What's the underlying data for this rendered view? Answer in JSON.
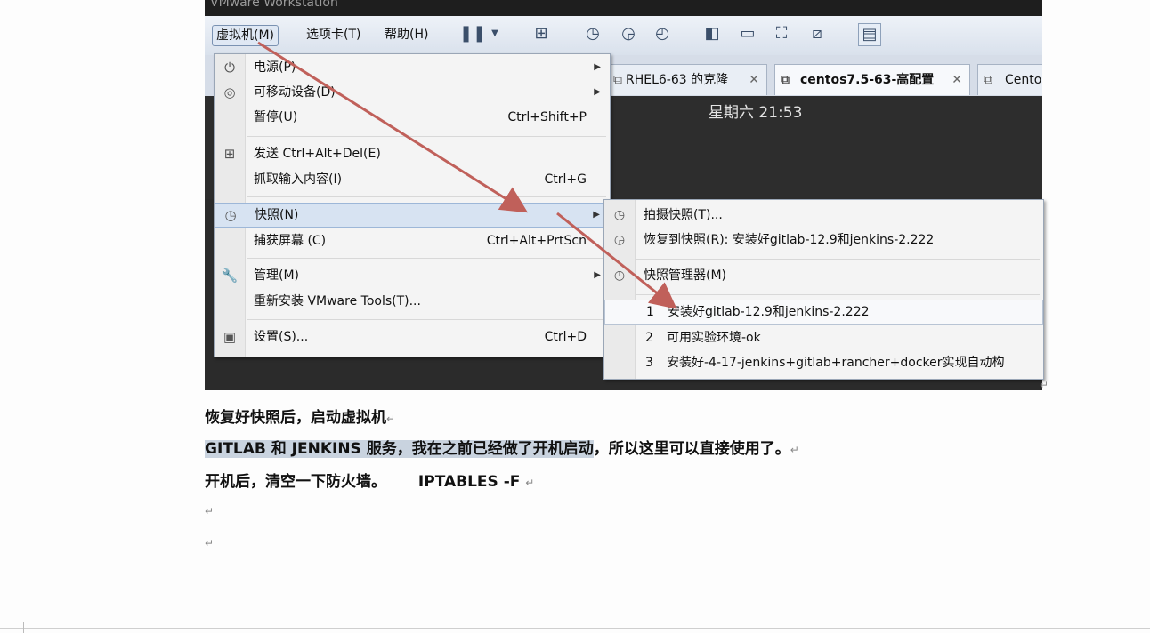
{
  "window": {
    "title": "VMware Workstation"
  },
  "menubar": {
    "vm": "虚拟机(M)",
    "tabs": "选项卡(T)",
    "help": "帮助(H)"
  },
  "tabs": [
    {
      "label": "RHEL6-63 的克隆",
      "active": false
    },
    {
      "label": "centos7.5-63-高配置",
      "active": true
    },
    {
      "label": "Centos",
      "active": false
    }
  ],
  "console": {
    "clock": "星期六 21:53"
  },
  "menu": {
    "items": [
      {
        "label": "电源(P)",
        "shortcut": "",
        "submenu": true,
        "icon": "power-icon"
      },
      {
        "label": "可移动设备(D)",
        "shortcut": "",
        "submenu": true,
        "icon": "disc-icon"
      },
      {
        "label": "暂停(U)",
        "shortcut": "Ctrl+Shift+P",
        "submenu": false,
        "icon": ""
      },
      {
        "label": "发送 Ctrl+Alt+Del(E)",
        "shortcut": "",
        "submenu": false,
        "icon": "network-send-icon"
      },
      {
        "label": "抓取输入内容(I)",
        "shortcut": "Ctrl+G",
        "submenu": false,
        "icon": ""
      },
      {
        "label": "快照(N)",
        "shortcut": "",
        "submenu": true,
        "icon": "snapshot-icon"
      },
      {
        "label": "捕获屏幕 (C)",
        "shortcut": "Ctrl+Alt+PrtScn",
        "submenu": false,
        "icon": ""
      },
      {
        "label": "管理(M)",
        "shortcut": "",
        "submenu": true,
        "icon": "wrench-icon"
      },
      {
        "label": "重新安装 VMware Tools(T)...",
        "shortcut": "",
        "submenu": false,
        "icon": ""
      },
      {
        "label": "设置(S)...",
        "shortcut": "Ctrl+D",
        "submenu": false,
        "icon": "settings-icon"
      }
    ]
  },
  "snapshot_menu": {
    "take": "拍摄快照(T)...",
    "revert": "恢复到快照(R): 安装好gitlab-12.9和jenkins-2.222",
    "manager": "快照管理器(M)",
    "list": [
      {
        "num": "1",
        "label": "安装好gitlab-12.9和jenkins-2.222"
      },
      {
        "num": "2",
        "label": "可用实验环境-ok"
      },
      {
        "num": "3",
        "label": "安装好-4-17-jenkins+gitlab+rancher+docker实现自动构"
      }
    ]
  },
  "doc": {
    "line1": "恢复好快照后，启动虚拟机",
    "line2_a": "GITLAB 和 JENKINS 服务，我在之前已经做了开机启动",
    "line2_b": "，所以这里可以直接使用了。",
    "line3_a": "开机后，清空一下防火墙。",
    "line3_b": "IPTABLES -F",
    "return_mark": "↵"
  },
  "colors": {
    "arrow": "#c0605a",
    "highlight": "#c9d3df",
    "menu_bg": "#f4f4f4"
  }
}
